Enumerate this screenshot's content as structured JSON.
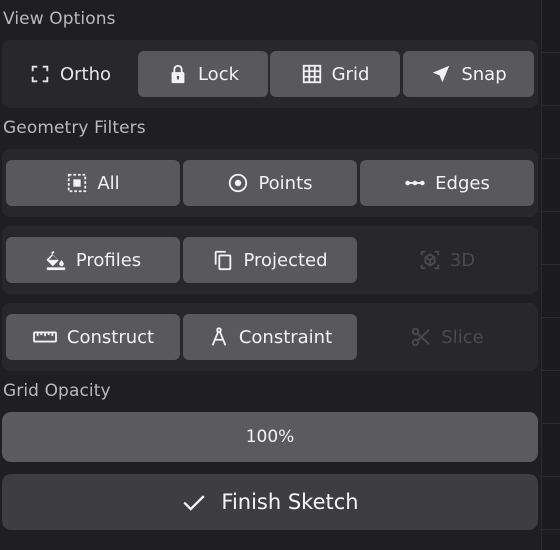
{
  "view_options": {
    "label": "View Options",
    "ortho": "Ortho",
    "lock": "Lock",
    "grid": "Grid",
    "snap": "Snap"
  },
  "geometry_filters": {
    "label": "Geometry Filters",
    "all": "All",
    "points": "Points",
    "edges": "Edges",
    "profiles": "Profiles",
    "projected": "Projected",
    "three_d": "3D",
    "construct": "Construct",
    "constraint": "Constraint",
    "slice": "Slice"
  },
  "grid_opacity": {
    "label": "Grid Opacity",
    "value": "100%"
  },
  "finish": {
    "label": "Finish Sketch"
  },
  "colors": {
    "panel_bg": "#1f1f22",
    "group_bg": "#28282c",
    "button_bg": "#58585d",
    "disabled_text": "#4a4a4f",
    "finish_bg": "#3d3d42"
  }
}
